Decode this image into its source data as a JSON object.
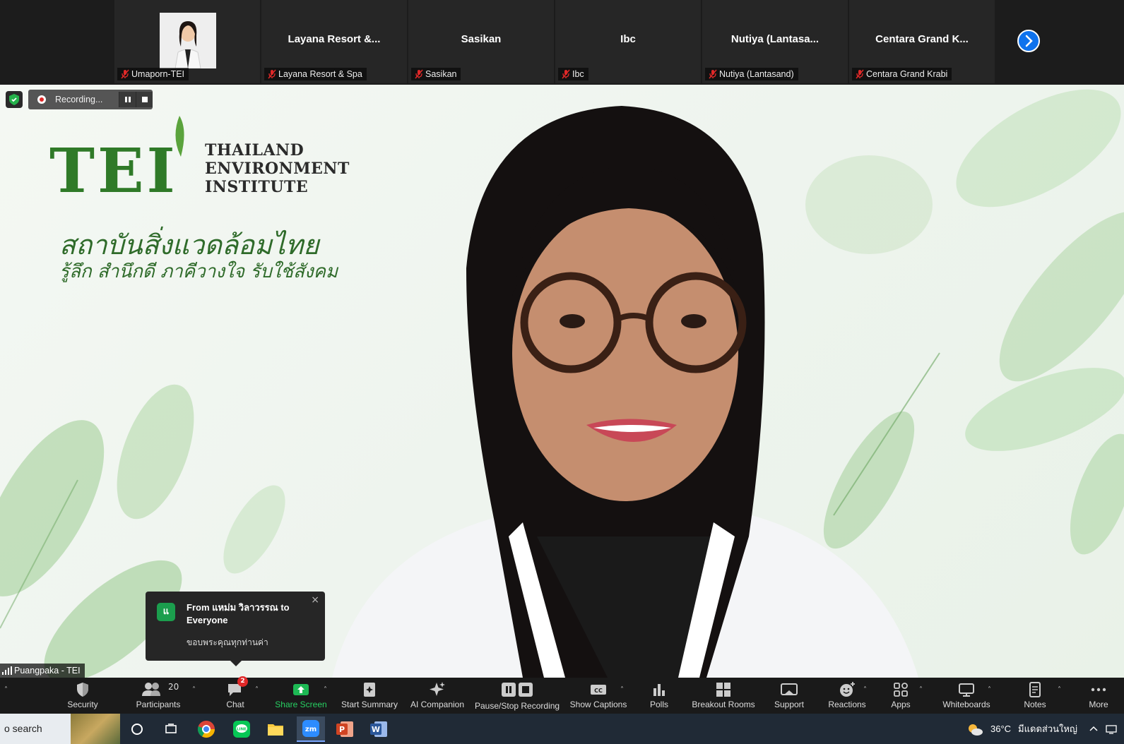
{
  "participants": [
    {
      "big_name": "",
      "label": "Umaporn-TEI",
      "has_photo": true
    },
    {
      "big_name": "Layana Resort &...",
      "label": "Layana Resort & Spa"
    },
    {
      "big_name": "Sasikan",
      "label": "Sasikan"
    },
    {
      "big_name": "Ibc",
      "label": "Ibc"
    },
    {
      "big_name": "Nutiya (Lantasa...",
      "label": "Nutiya (Lantasand)"
    },
    {
      "big_name": "Centara Grand K...",
      "label": "Centara Grand Krabi"
    }
  ],
  "recording": {
    "label": "Recording..."
  },
  "background": {
    "logo": "TEI",
    "org_line1": "THAILAND",
    "org_line2": "ENVIRONMENT",
    "org_line3": "INSTITUTE",
    "thai_title": "สถาบันสิ่งแวดล้อมไทย",
    "thai_slogan": "รู้ลึก สำนึกดี ภาคีวางใจ รับใช้สังคม"
  },
  "speaker": {
    "label": "Puangpaka - TEI"
  },
  "chat_popup": {
    "avatar_letter": "แ",
    "from": "From แหม่ม วิลาวรรณ to Everyone",
    "message": "ขอบพระคุณทุกท่านค่า",
    "close": "×"
  },
  "toolbar": {
    "participant_count": "20",
    "chat_badge": "2",
    "items": [
      {
        "label": "Security"
      },
      {
        "label": "Participants"
      },
      {
        "label": "Chat"
      },
      {
        "label": "Share Screen"
      },
      {
        "label": "Start Summary"
      },
      {
        "label": "AI Companion"
      },
      {
        "label": "Pause/Stop Recording"
      },
      {
        "label": "Show Captions"
      },
      {
        "label": "Polls"
      },
      {
        "label": "Breakout Rooms"
      },
      {
        "label": "Support"
      },
      {
        "label": "Reactions"
      },
      {
        "label": "Apps"
      },
      {
        "label": "Whiteboards"
      },
      {
        "label": "Notes"
      },
      {
        "label": "More"
      }
    ]
  },
  "taskbar": {
    "search_text": "o search",
    "temperature": "36°C",
    "weather": "มีแดดส่วนใหญ่"
  },
  "colors": {
    "accent_blue": "#0e72ed",
    "share_green": "#1db954",
    "chat_green": "#1b9e4d",
    "mute_red": "#e02828",
    "tei_green": "#2f7a28"
  }
}
